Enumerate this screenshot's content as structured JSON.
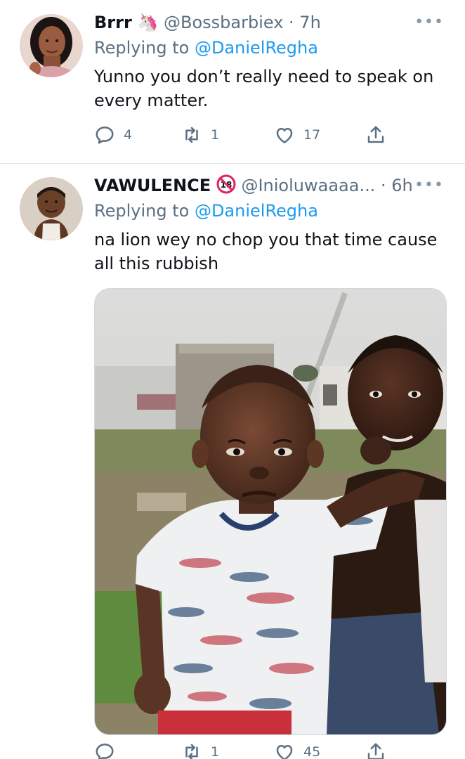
{
  "tweets": [
    {
      "display_name": "Brrr",
      "name_emoji": "🦄",
      "handle": "@Bossbarbiex",
      "time_sep": " · ",
      "time": "7h",
      "replying_prefix": "Replying to ",
      "replying_to": "@DanielRegha",
      "text": "Yunno you don’t really need to speak on every matter.",
      "replies": "4",
      "retweets": "1",
      "likes": "17"
    },
    {
      "display_name": "VAWULENCE",
      "handle": "@Inioluwaaaa...",
      "time_sep": " · ",
      "time": "6h",
      "replying_prefix": "Replying to ",
      "replying_to": "@DanielRegha",
      "text": "na lion wey no chop you that time cause all this rubbish",
      "replies": "",
      "retweets": "1",
      "likes": "45"
    }
  ],
  "more_glyph": "•••",
  "icons": {
    "reply": "reply-icon",
    "retweet": "retweet-icon",
    "like": "heart-icon",
    "share": "share-icon",
    "more": "more-icon",
    "no18": "no-under-18-icon",
    "unicorn": "unicorn-emoji"
  },
  "colors": {
    "accent": "#1d9bf0",
    "muted": "#5b7083",
    "text": "#0f1419",
    "divider": "#e1e5e8"
  }
}
